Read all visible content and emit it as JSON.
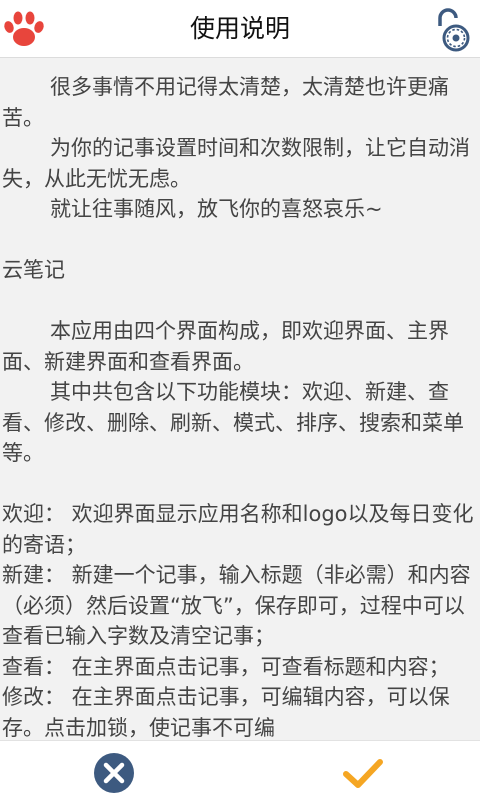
{
  "header": {
    "title": "使用说明",
    "left_icon": "paw-icon",
    "right_icon": "unlock-icon"
  },
  "content": {
    "paragraphs": [
      "很多事情不用记得太清楚，太清楚也许更痛苦。",
      "为你的记事设置时间和次数限制，让它自动消失，从此无忧无虑。",
      "就让往事随风，放飞你的喜怒哀乐~",
      "云笔记",
      "本应用由四个界面构成，即欢迎界面、主界面、新建界面和查看界面。",
      "其中共包含以下功能模块：欢迎、新建、查看、修改、删除、刷新、模式、排序、搜索和菜单等。",
      "欢迎： 欢迎界面显示应用名称和logo以及每日变化的寄语；",
      "新建： 新建一个记事，输入标题（非必需）和内容（必须）然后设置“放飞”，保存即可，过程中可以查看已输入字数及清空记事；",
      "查看： 在主界面点击记事，可查看标题和内容；",
      "修改： 在主界面点击记事，可编辑内容，可以保存。点击加锁，使记事不可编"
    ]
  },
  "footer": {
    "cancel_icon": "close-icon",
    "confirm_icon": "check-icon"
  },
  "colors": {
    "accent_red": "#e8453c",
    "icon_blue": "#3d5a80",
    "check_orange": "#f5a623",
    "text": "#444444",
    "background": "#f2f2f2"
  }
}
